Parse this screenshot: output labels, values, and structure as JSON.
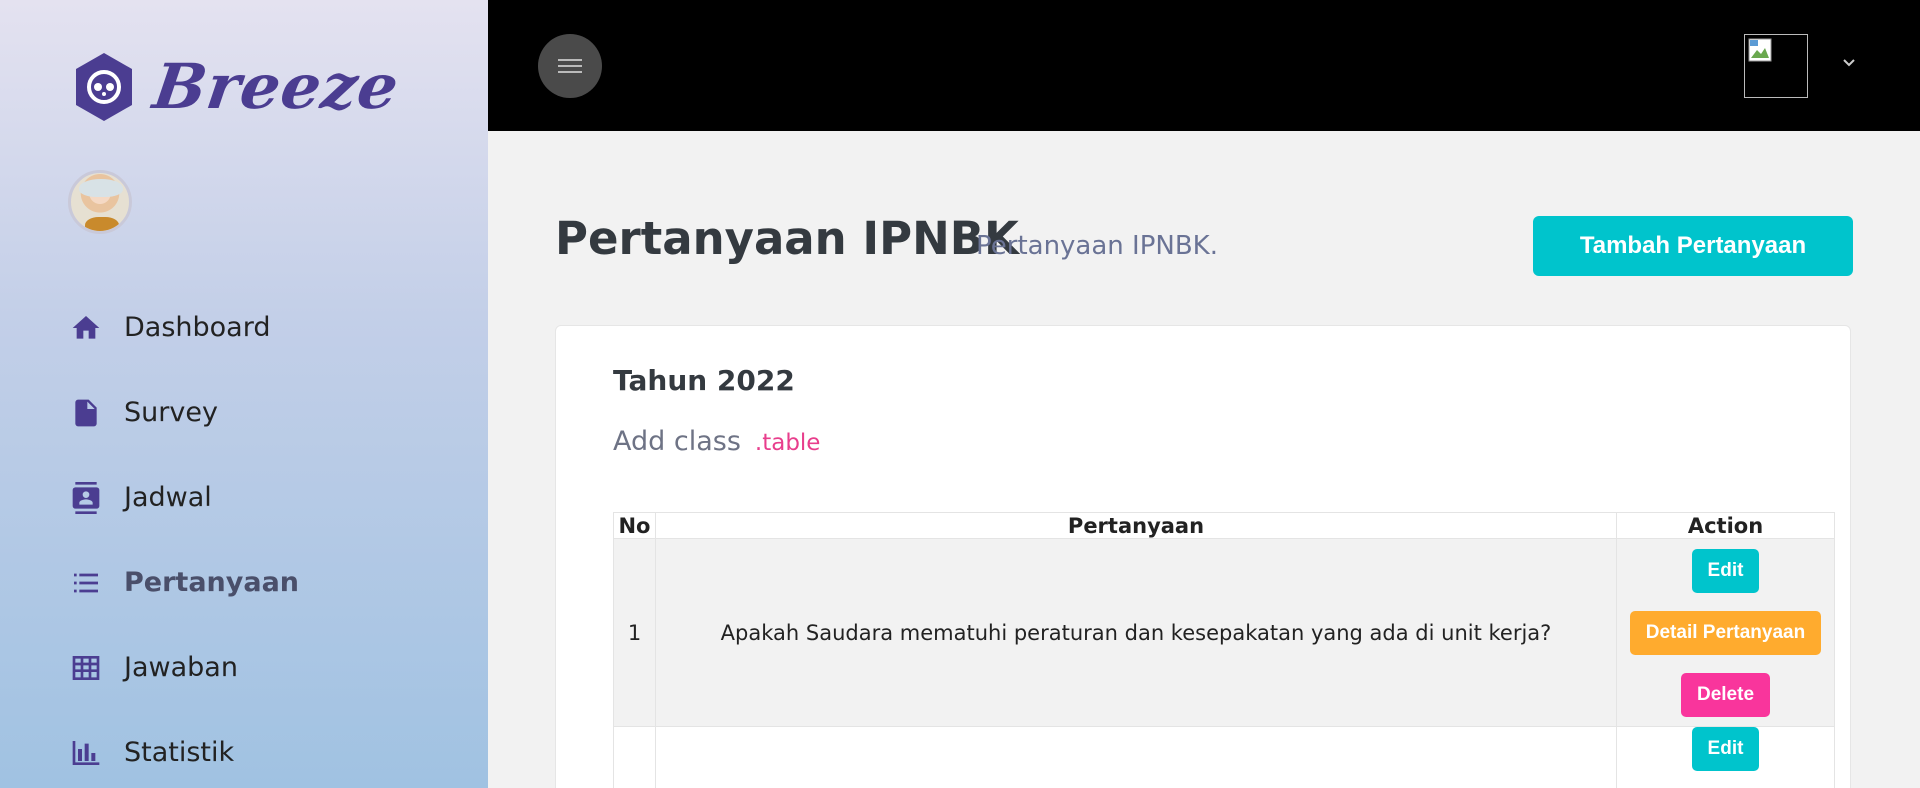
{
  "brand": {
    "name": "Breeze"
  },
  "sidebar": {
    "items": [
      {
        "label": "Dashboard",
        "icon": "home-icon"
      },
      {
        "label": "Survey",
        "icon": "document-icon"
      },
      {
        "label": "Jadwal",
        "icon": "contact-book-icon"
      },
      {
        "label": "Pertanyaan",
        "icon": "list-icon",
        "active": true
      },
      {
        "label": "Jawaban",
        "icon": "grid-table-icon"
      },
      {
        "label": "Statistik",
        "icon": "bar-chart-icon"
      }
    ]
  },
  "page": {
    "title": "Pertanyaan IPNBK",
    "subtitle": "Pertanyaan IPNBK.",
    "add_button": "Tambah Pertanyaan"
  },
  "card": {
    "title": "Tahun 2022",
    "desc": "Add class",
    "desc_code": ".table"
  },
  "table": {
    "headers": {
      "no": "No",
      "question": "Pertanyaan",
      "action": "Action"
    },
    "rows": [
      {
        "no": "1",
        "question": "Apakah Saudara mematuhi peraturan dan kesepakatan yang ada di unit kerja?",
        "edit": "Edit",
        "detail": "Detail Pertanyaan",
        "delete": "Delete"
      },
      {
        "no": "",
        "question": "",
        "edit": "Edit"
      }
    ]
  },
  "colors": {
    "accent": "#00c4cc",
    "brand": "#4b3d91",
    "detail": "#ffab2e",
    "delete": "#f9359c"
  }
}
